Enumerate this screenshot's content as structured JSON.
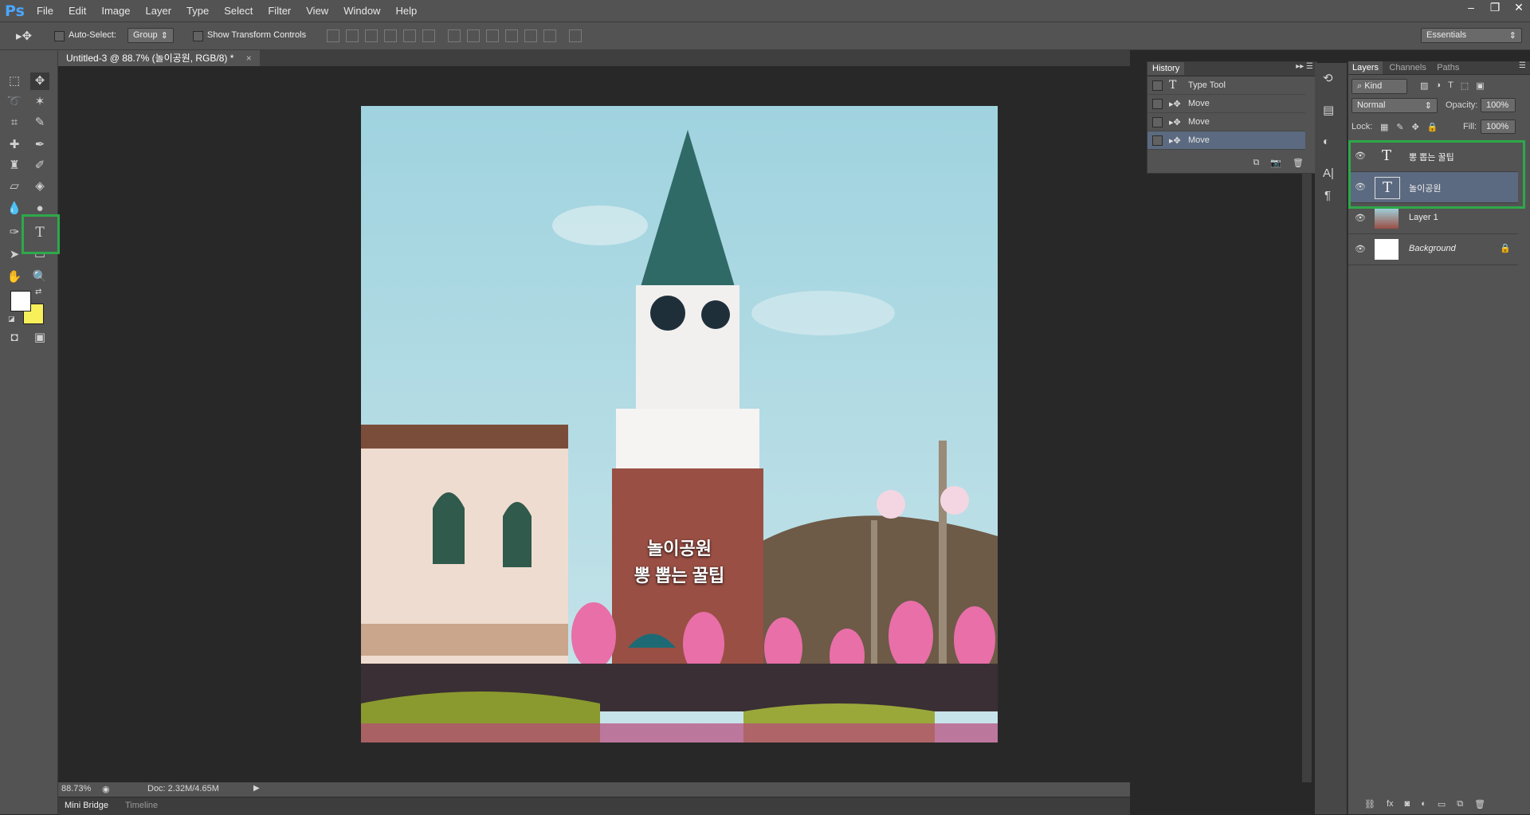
{
  "app": {
    "logo": "Ps"
  },
  "menu": [
    "File",
    "Edit",
    "Image",
    "Layer",
    "Type",
    "Select",
    "Filter",
    "View",
    "Window",
    "Help"
  ],
  "window_controls": {
    "minimize": "–",
    "restore": "❐",
    "close": "✕"
  },
  "options": {
    "auto_select_label": "Auto-Select:",
    "auto_select_value": "Group",
    "show_transform_label": "Show Transform Controls",
    "workspace": "Essentials"
  },
  "document": {
    "tab_title": "Untitled-3 @ 88.7% (놀이공원, RGB/8) *",
    "close": "×",
    "overlay_line1": "놀이공원",
    "overlay_line2": "뽕 뽑는 꿀팁"
  },
  "status": {
    "zoom": "88.73%",
    "doc": "Doc: 2.32M/4.65M"
  },
  "bottom_tabs": [
    "Mini Bridge",
    "Timeline"
  ],
  "history": {
    "title": "History",
    "items": [
      {
        "label": "Type Tool",
        "icon": "type-icon"
      },
      {
        "label": "Move",
        "icon": "move-icon"
      },
      {
        "label": "Move",
        "icon": "move-icon"
      },
      {
        "label": "Move",
        "icon": "move-icon",
        "selected": true
      }
    ]
  },
  "layers_panel": {
    "tabs": [
      "Layers",
      "Channels",
      "Paths"
    ],
    "filter": "Kind",
    "blend_mode": "Normal",
    "opacity_label": "Opacity:",
    "opacity": "100%",
    "lock_label": "Lock:",
    "fill_label": "Fill:",
    "fill": "100%",
    "layers": [
      {
        "name": "뽕 뽑는 꿀팁",
        "type": "text"
      },
      {
        "name": "놀이공원",
        "type": "text",
        "selected": true
      },
      {
        "name": "Layer 1",
        "type": "image"
      },
      {
        "name": "Background",
        "type": "background",
        "locked": true
      }
    ]
  },
  "colors": {
    "accent_highlight": "#2ea84a",
    "selection": "#5b6a80"
  }
}
